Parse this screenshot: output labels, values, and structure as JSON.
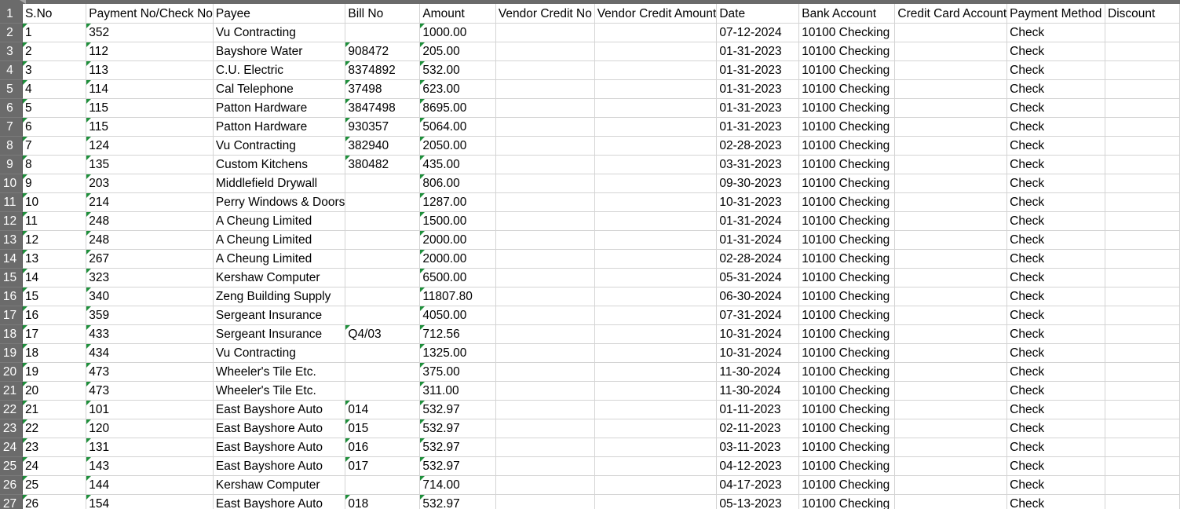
{
  "sheet": {
    "column_headers": [
      "S.No",
      "Payment No/Check No",
      "Payee",
      "Bill No",
      "Amount",
      "Vendor Credit No",
      "Vendor Credit Amount",
      "Date",
      "Bank Account",
      "Credit Card Account",
      "Payment Method",
      "Discount"
    ],
    "header_row_number": "1",
    "rows": [
      {
        "row": "2",
        "cells": [
          "1",
          "352",
          "Vu Contracting",
          "",
          "1000.00",
          "",
          "",
          "07-12-2024",
          "10100 Checking",
          "",
          "Check",
          ""
        ]
      },
      {
        "row": "3",
        "cells": [
          "2",
          "112",
          "Bayshore Water",
          "908472",
          "205.00",
          "",
          "",
          "01-31-2023",
          "10100 Checking",
          "",
          "Check",
          ""
        ]
      },
      {
        "row": "4",
        "cells": [
          "3",
          "113",
          "C.U. Electric",
          "8374892",
          "532.00",
          "",
          "",
          "01-31-2023",
          "10100 Checking",
          "",
          "Check",
          ""
        ]
      },
      {
        "row": "5",
        "cells": [
          "4",
          "114",
          "Cal Telephone",
          "37498",
          "623.00",
          "",
          "",
          "01-31-2023",
          "10100 Checking",
          "",
          "Check",
          ""
        ]
      },
      {
        "row": "6",
        "cells": [
          "5",
          "115",
          "Patton Hardware",
          "3847498",
          "8695.00",
          "",
          "",
          "01-31-2023",
          "10100 Checking",
          "",
          "Check",
          ""
        ]
      },
      {
        "row": "7",
        "cells": [
          "6",
          "115",
          "Patton Hardware",
          "930357",
          "5064.00",
          "",
          "",
          "01-31-2023",
          "10100 Checking",
          "",
          "Check",
          ""
        ]
      },
      {
        "row": "8",
        "cells": [
          "7",
          "124",
          "Vu Contracting",
          "382940",
          "2050.00",
          "",
          "",
          "02-28-2023",
          "10100 Checking",
          "",
          "Check",
          ""
        ]
      },
      {
        "row": "9",
        "cells": [
          "8",
          "135",
          "Custom Kitchens",
          "380482",
          "435.00",
          "",
          "",
          "03-31-2023",
          "10100 Checking",
          "",
          "Check",
          ""
        ]
      },
      {
        "row": "10",
        "cells": [
          "9",
          "203",
          "Middlefield Drywall",
          "",
          "806.00",
          "",
          "",
          "09-30-2023",
          "10100 Checking",
          "",
          "Check",
          ""
        ]
      },
      {
        "row": "11",
        "cells": [
          "10",
          "214",
          "Perry Windows & Doors",
          "",
          "1287.00",
          "",
          "",
          "10-31-2023",
          "10100 Checking",
          "",
          "Check",
          ""
        ]
      },
      {
        "row": "12",
        "cells": [
          "11",
          "248",
          "A Cheung Limited",
          "",
          "1500.00",
          "",
          "",
          "01-31-2024",
          "10100 Checking",
          "",
          "Check",
          ""
        ]
      },
      {
        "row": "13",
        "cells": [
          "12",
          "248",
          "A Cheung Limited",
          "",
          "2000.00",
          "",
          "",
          "01-31-2024",
          "10100 Checking",
          "",
          "Check",
          ""
        ]
      },
      {
        "row": "14",
        "cells": [
          "13",
          "267",
          "A Cheung Limited",
          "",
          "2000.00",
          "",
          "",
          "02-28-2024",
          "10100 Checking",
          "",
          "Check",
          ""
        ]
      },
      {
        "row": "15",
        "cells": [
          "14",
          "323",
          "Kershaw Computer",
          "",
          "6500.00",
          "",
          "",
          "05-31-2024",
          "10100 Checking",
          "",
          "Check",
          ""
        ]
      },
      {
        "row": "16",
        "cells": [
          "15",
          "340",
          "Zeng Building Supply",
          "",
          "11807.80",
          "",
          "",
          "06-30-2024",
          "10100 Checking",
          "",
          "Check",
          ""
        ]
      },
      {
        "row": "17",
        "cells": [
          "16",
          "359",
          "Sergeant Insurance",
          "",
          "4050.00",
          "",
          "",
          "07-31-2024",
          "10100 Checking",
          "",
          "Check",
          ""
        ]
      },
      {
        "row": "18",
        "cells": [
          "17",
          "433",
          "Sergeant Insurance",
          "Q4/03",
          "712.56",
          "",
          "",
          "10-31-2024",
          "10100 Checking",
          "",
          "Check",
          ""
        ]
      },
      {
        "row": "19",
        "cells": [
          "18",
          "434",
          "Vu Contracting",
          "",
          "1325.00",
          "",
          "",
          "10-31-2024",
          "10100 Checking",
          "",
          "Check",
          ""
        ]
      },
      {
        "row": "20",
        "cells": [
          "19",
          "473",
          "Wheeler's Tile Etc.",
          "",
          "375.00",
          "",
          "",
          "11-30-2024",
          "10100 Checking",
          "",
          "Check",
          ""
        ]
      },
      {
        "row": "21",
        "cells": [
          "20",
          "473",
          "Wheeler's Tile Etc.",
          "",
          "311.00",
          "",
          "",
          "11-30-2024",
          "10100 Checking",
          "",
          "Check",
          ""
        ]
      },
      {
        "row": "22",
        "cells": [
          "21",
          "101",
          "East Bayshore Auto",
          "014",
          "532.97",
          "",
          "",
          "01-11-2023",
          "10100 Checking",
          "",
          "Check",
          ""
        ]
      },
      {
        "row": "23",
        "cells": [
          "22",
          "120",
          "East Bayshore Auto",
          "015",
          "532.97",
          "",
          "",
          "02-11-2023",
          "10100 Checking",
          "",
          "Check",
          ""
        ]
      },
      {
        "row": "24",
        "cells": [
          "23",
          "131",
          "East Bayshore Auto",
          "016",
          "532.97",
          "",
          "",
          "03-11-2023",
          "10100 Checking",
          "",
          "Check",
          ""
        ]
      },
      {
        "row": "25",
        "cells": [
          "24",
          "143",
          "East Bayshore Auto",
          "017",
          "532.97",
          "",
          "",
          "04-12-2023",
          "10100 Checking",
          "",
          "Check",
          ""
        ]
      },
      {
        "row": "26",
        "cells": [
          "25",
          "144",
          "Kershaw Computer",
          "",
          "714.00",
          "",
          "",
          "04-17-2023",
          "10100 Checking",
          "",
          "Check",
          ""
        ]
      },
      {
        "row": "27",
        "cells": [
          "26",
          "154",
          "East Bayshore Auto",
          "018",
          "532.97",
          "",
          "",
          "05-13-2023",
          "10100 Checking",
          "",
          "Check",
          ""
        ]
      }
    ]
  }
}
